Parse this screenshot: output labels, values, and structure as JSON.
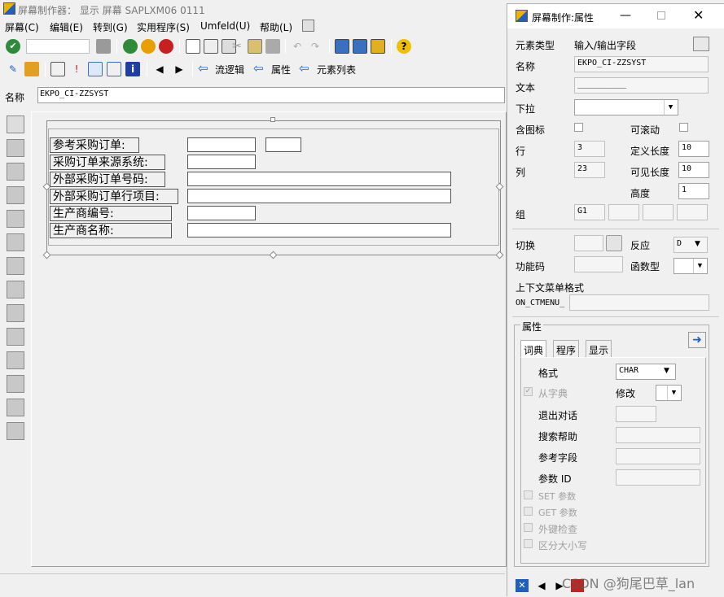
{
  "main_window": {
    "title": "屏幕制作器： 显示 屏幕 SAPLXM06 0111",
    "menu": [
      "屏幕(C)",
      "编辑(E)",
      "转到(G)",
      "实用程序(S)",
      "Umfeld(U)",
      "帮助(L)"
    ],
    "toolbar2": {
      "flow_logic": "流逻辑",
      "attributes": "属性",
      "element_list": "元素列表"
    },
    "name_label": "名称",
    "name_value": "EKPO_CI-ZZSYST",
    "canvas_labels": [
      "参考采购订单:",
      "采购订单来源系统:",
      "外部采购订单号码:",
      "外部采购订单行项目:",
      "生产商编号:",
      "生产商名称:"
    ]
  },
  "props": {
    "title": "屏幕制作:属性",
    "element_type_label": "元素类型",
    "element_type_value": "输入/输出字段",
    "name_label": "名称",
    "name_value": "EKPO_CI-ZZSYST",
    "text_label": "文本",
    "text_value": "__________",
    "dropdown_label": "下拉",
    "with_icon_label": "含图标",
    "scrollable_label": "可滚动",
    "row_label": "行",
    "row_value": "3",
    "def_len_label": "定义长度",
    "def_len_value": "10",
    "col_label": "列",
    "col_value": "23",
    "vis_len_label": "可见长度",
    "vis_len_value": "10",
    "height_label": "高度",
    "height_value": "1",
    "group_label": "组",
    "group_value": "G1",
    "toggle_label": "切换",
    "response_label": "反应",
    "response_value": "D",
    "fcode_label": "功能码",
    "ftype_label": "函数型",
    "ctx_menu_label": "上下文菜单格式",
    "ctx_menu_prefix": "ON_CTMENU_",
    "attr_group": "属性",
    "tabs": [
      "词典",
      "程序",
      "显示"
    ],
    "format_label": "格式",
    "format_value": "CHAR",
    "from_dict_label": "从字典",
    "modify_label": "修改",
    "exit_dialog_label": "退出对话",
    "search_help_label": "搜索帮助",
    "ref_field_label": "参考字段",
    "param_id_label": "参数 ID",
    "set_param_label": "SET 参数",
    "get_param_label": "GET 参数",
    "foreign_key_label": "外键检查",
    "case_label": "区分大小写"
  },
  "watermark": "CSDN @狗尾巴草_lan",
  "colors": {
    "window_bg": "#f0f0f0",
    "accent_blue": "#1f5fbf",
    "field_border": "#9c9c9c"
  }
}
